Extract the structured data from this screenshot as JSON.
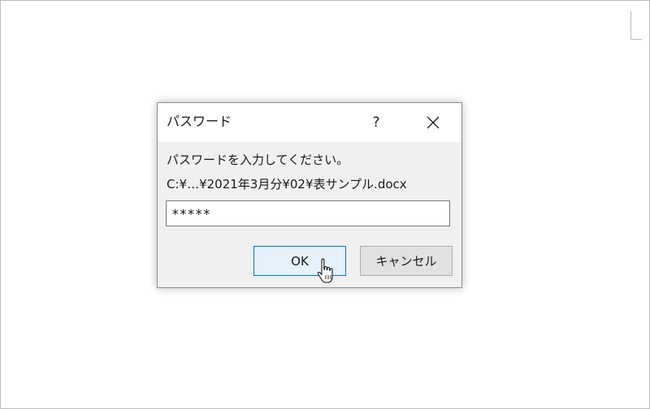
{
  "dialog": {
    "title": "パスワード",
    "help_glyph": "?",
    "prompt": "パスワードを入力してください。",
    "file_path": "C:¥…¥2021年3月分¥02¥表サンプル.docx",
    "password_value": "*****",
    "ok_label": "OK",
    "cancel_label": "キャンセル"
  },
  "colors": {
    "dialog_bg": "#f0f0f0",
    "ok_border": "#0078d7",
    "ok_bg": "#e5f1fb",
    "cancel_bg": "#e1e1e1"
  },
  "icons": {
    "close": "close-icon",
    "cursor": "hand-pointer-cursor-icon"
  }
}
